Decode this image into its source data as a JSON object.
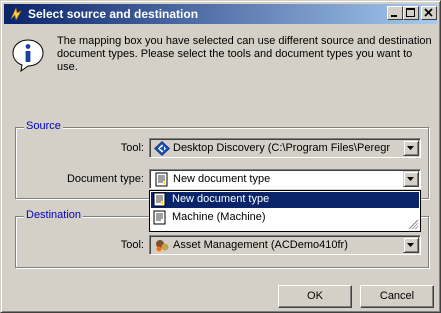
{
  "window": {
    "title": "Select source and destination",
    "controls": [
      "minimize-icon",
      "maximize-icon",
      "close-icon"
    ]
  },
  "message": {
    "icon": "info-icon",
    "text": "The mapping box you have selected can use different source and destination document types. Please select the tools and document types you want to use."
  },
  "source": {
    "legend": "Source",
    "tool_label": "Tool:",
    "tool_value": "Desktop Discovery (C:\\Program Files\\Peregr",
    "tool_icon": "desktop-discovery-icon",
    "doctype_label": "Document type:",
    "doctype_value": "New document type",
    "doctype_icon": "document-icon"
  },
  "dropdown": {
    "options": [
      {
        "label": "New document type",
        "icon": "document-icon",
        "selected": true
      },
      {
        "label": "Machine (Machine)",
        "icon": "document-icon",
        "selected": false
      }
    ]
  },
  "destination": {
    "legend": "Destination",
    "tool_label": "Tool:",
    "tool_value": "Asset Management (ACDemo410fr)",
    "tool_icon": "asset-management-icon"
  },
  "buttons": {
    "ok": "OK",
    "cancel": "Cancel"
  },
  "colors": {
    "titlebar_start": "#0a246a",
    "titlebar_end": "#a6caf0",
    "legend": "#0000c0",
    "selection": "#0a246a",
    "dialog_face": "#d4d0c8"
  }
}
